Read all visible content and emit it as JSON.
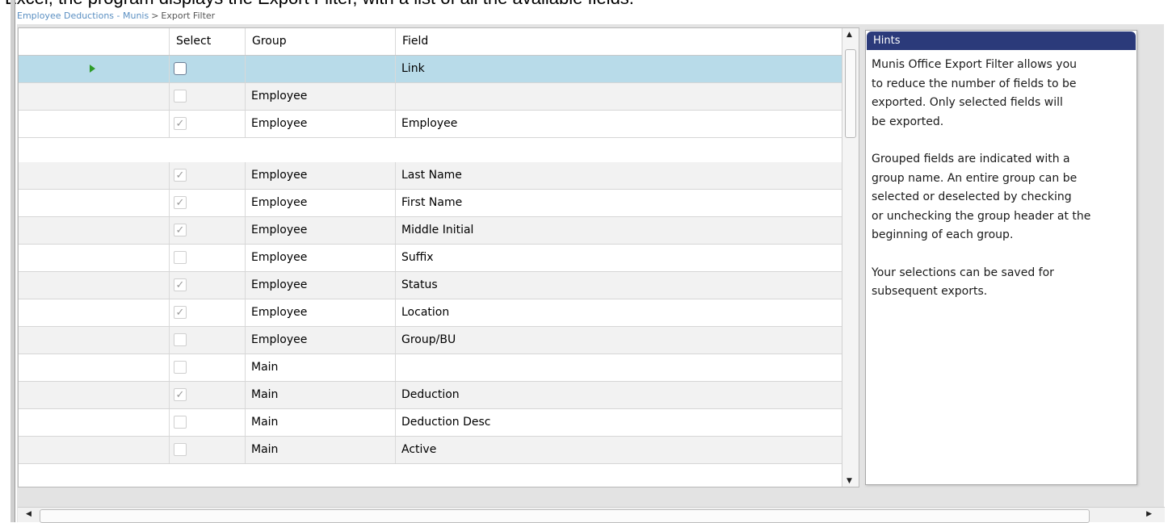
{
  "caption": "Excel, the program displays the Export Filter, with a list of all the available fields.",
  "breadcrumb": {
    "link": "Employee Deductions - Munis",
    "separator": ">",
    "current": "Export Filter"
  },
  "columns": {
    "select": "Select",
    "group": "Group",
    "field": "Field"
  },
  "rows": [
    {
      "group": "",
      "field": "Link",
      "checked": false,
      "current": true
    },
    {
      "group": "Employee",
      "field": "",
      "checked": false
    },
    {
      "group": "Employee",
      "field": "Employee",
      "checked": true
    },
    {
      "group": "Employee",
      "field": "Last Name",
      "checked": true
    },
    {
      "group": "Employee",
      "field": "First Name",
      "checked": true
    },
    {
      "group": "Employee",
      "field": "Middle Initial",
      "checked": true
    },
    {
      "group": "Employee",
      "field": "Suffix",
      "checked": false
    },
    {
      "group": "Employee",
      "field": "Status",
      "checked": true
    },
    {
      "group": "Employee",
      "field": "Location",
      "checked": true
    },
    {
      "group": "Employee",
      "field": "Group/BU",
      "checked": false
    },
    {
      "group": "Main",
      "field": "",
      "checked": false
    },
    {
      "group": "Main",
      "field": "Deduction",
      "checked": true
    },
    {
      "group": "Main",
      "field": "Deduction Desc",
      "checked": false
    },
    {
      "group": "Main",
      "field": "Active",
      "checked": false
    }
  ],
  "checkmark": "✓",
  "hints": {
    "title": "Hints",
    "p1": "Munis Office Export Filter allows you\nto reduce the number of fields to be\nexported. Only selected fields will\nbe exported.",
    "p2": "Grouped fields are indicated with a\ngroup name. An entire group can be\nselected or deselected by checking\nor unchecking the group header at the\nbeginning of each group.",
    "p3": "Your selections can be saved for\nsubsequent exports."
  },
  "icons": {
    "scroll_up": "▲",
    "scroll_down": "▼",
    "scroll_left": "◀",
    "scroll_right": "▶",
    "row_pointer": "current-row-arrow-icon"
  },
  "colors": {
    "selected_row": "#b8dbe9",
    "hints_header": "#2b3a7a",
    "pointer": "#2e9c28",
    "breadcrumb_link": "#5a8fc2"
  }
}
